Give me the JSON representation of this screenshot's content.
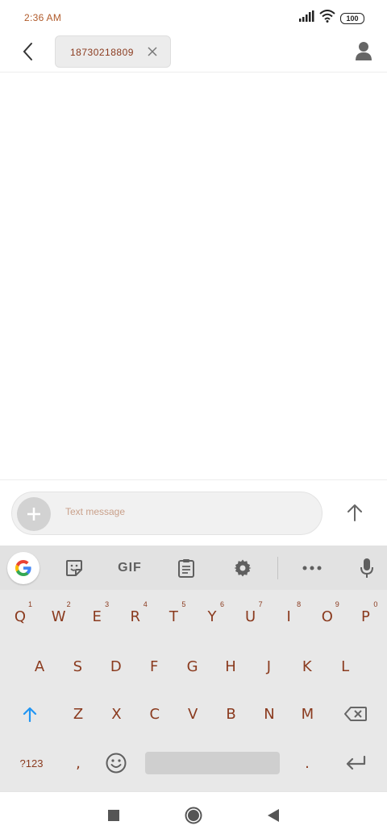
{
  "status_bar": {
    "time": "2:36 AM",
    "battery": "100",
    "icons": [
      "signal-icon",
      "wifi-icon",
      "battery-icon"
    ]
  },
  "header": {
    "recipient_number": "18730218809",
    "icons": [
      "back-icon",
      "close-icon",
      "contact-icon"
    ]
  },
  "compose": {
    "placeholder": "Text message",
    "value": "",
    "icons": [
      "plus-icon",
      "send-arrow-icon"
    ]
  },
  "keyboard": {
    "toolbar": {
      "gif_label": "GIF",
      "icons": [
        "google-icon",
        "sticker-icon",
        "clipboard-icon",
        "gear-icon",
        "more-icon",
        "mic-icon"
      ]
    },
    "row1": [
      {
        "label": "Q",
        "hint": "1"
      },
      {
        "label": "W",
        "hint": "2"
      },
      {
        "label": "E",
        "hint": "3"
      },
      {
        "label": "R",
        "hint": "4"
      },
      {
        "label": "T",
        "hint": "5"
      },
      {
        "label": "Y",
        "hint": "6"
      },
      {
        "label": "U",
        "hint": "7"
      },
      {
        "label": "I",
        "hint": "8"
      },
      {
        "label": "O",
        "hint": "9"
      },
      {
        "label": "P",
        "hint": "0"
      }
    ],
    "row2": [
      "A",
      "S",
      "D",
      "F",
      "G",
      "H",
      "J",
      "K",
      "L"
    ],
    "row3": [
      "Z",
      "X",
      "C",
      "V",
      "B",
      "N",
      "M"
    ],
    "row4": {
      "symbols_label": "?123",
      "comma": ",",
      "period": "."
    },
    "accent_color": "#8a3a1e",
    "shift_color": "#2196f3"
  },
  "nav_bar": {
    "icons": [
      "recents-square-icon",
      "home-circle-icon",
      "back-triangle-icon"
    ]
  }
}
